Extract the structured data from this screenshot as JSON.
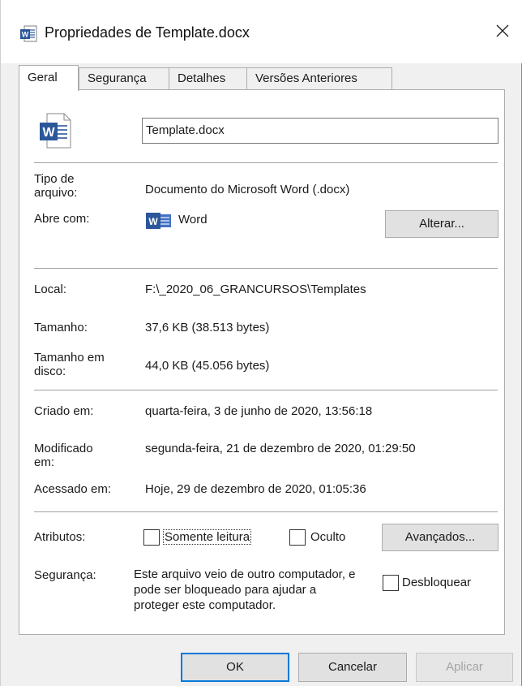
{
  "window": {
    "title": "Propriedades de Template.docx"
  },
  "tabs": [
    {
      "label": "Geral",
      "active": true
    },
    {
      "label": "Segurança",
      "active": false
    },
    {
      "label": "Detalhes",
      "active": false
    },
    {
      "label": "Versões Anteriores",
      "active": false
    }
  ],
  "general": {
    "file_name": "Template.docx",
    "type_label_1": "Tipo de",
    "type_label_2": "arquivo:",
    "type_value": "Documento do Microsoft Word (.docx)",
    "opens_with_label": "Abre com:",
    "opens_with_value": "Word",
    "change_button": "Alterar...",
    "location_label": "Local:",
    "location_value": "F:\\_2020_06_GRANCURSOS\\Templates",
    "size_label": "Tamanho:",
    "size_value": "37,6 KB (38.513 bytes)",
    "disk_size_label_1": "Tamanho em",
    "disk_size_label_2": "disco:",
    "disk_size_value": "44,0 KB (45.056 bytes)",
    "created_label": "Criado em:",
    "created_value": "quarta-feira, 3 de junho de 2020, 13:56:18",
    "modified_label_1": "Modificado",
    "modified_label_2": "em:",
    "modified_value": "segunda-feira, 21 de dezembro de 2020, 01:29:50",
    "accessed_label": "Acessado em:",
    "accessed_value": "Hoje, 29 de dezembro de 2020, 01:05:36",
    "attributes_label": "Atributos:",
    "readonly_label": "Somente leitura",
    "readonly_checked": false,
    "hidden_label": "Oculto",
    "hidden_checked": false,
    "advanced_button": "Avançados...",
    "security_label": "Segurança:",
    "security_text": "Este arquivo veio de outro computador, e pode ser bloqueado para ajudar a proteger este computador.",
    "unblock_label": "Desbloquear",
    "unblock_checked": false
  },
  "footer": {
    "ok": "OK",
    "cancel": "Cancelar",
    "apply": "Aplicar"
  },
  "icons": {
    "title": "word-document-icon",
    "file": "word-document-icon",
    "app": "word-app-icon",
    "close": "close-icon"
  },
  "colors": {
    "word_blue": "#2b579a",
    "focus_blue": "#0078d7"
  }
}
